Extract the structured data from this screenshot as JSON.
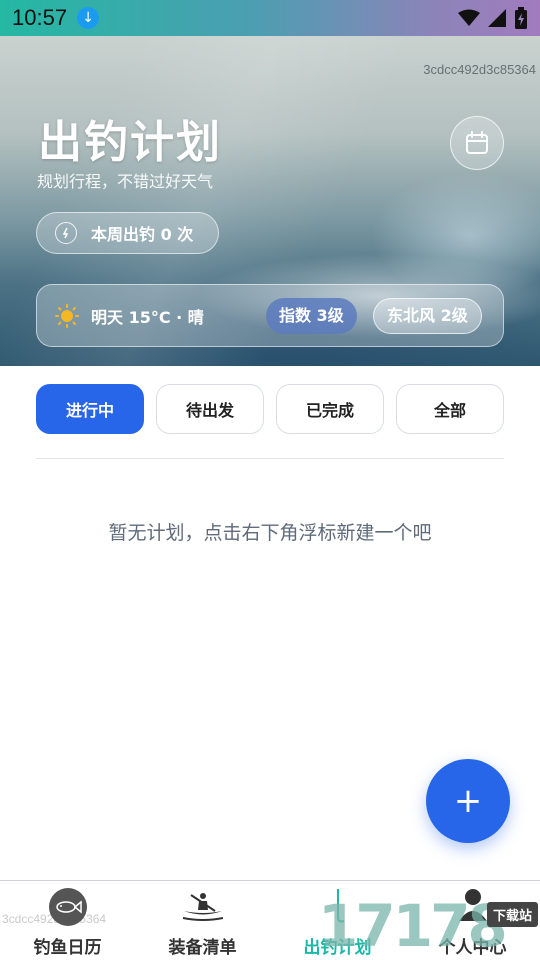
{
  "status_bar": {
    "time": "10:57"
  },
  "hero": {
    "id_text": "3cdcc492d3c85364",
    "title": "出钓计划",
    "subtitle": "规划行程，不错过好天气",
    "week_count": "本周出钓 0 次",
    "weather": {
      "summary": "明天 15°C · 晴",
      "index": "指数 3级",
      "wind": "东北风 2级"
    }
  },
  "tabs": [
    {
      "label": "进行中",
      "active": true
    },
    {
      "label": "待出发",
      "active": false
    },
    {
      "label": "已完成",
      "active": false
    },
    {
      "label": "全部",
      "active": false
    }
  ],
  "empty_message": "暂无计划，点击右下角浮标新建一个吧",
  "fab_label": "+",
  "bottom_nav": {
    "watermark": "3cdcc492d3c85364",
    "items": [
      {
        "label": "钓鱼日历",
        "icon": "fish-icon",
        "active": false
      },
      {
        "label": "装备清单",
        "icon": "kayak-icon",
        "active": false
      },
      {
        "label": "出钓计划",
        "icon": "plan-icon",
        "active": true
      },
      {
        "label": "个人中心",
        "icon": "person-icon",
        "active": false
      }
    ]
  },
  "brand": {
    "number": "17178",
    "site": "下载站"
  },
  "colors": {
    "primary": "#2766e8",
    "active_nav": "#1fb7a7",
    "index_chip": "#5c7bbe"
  }
}
